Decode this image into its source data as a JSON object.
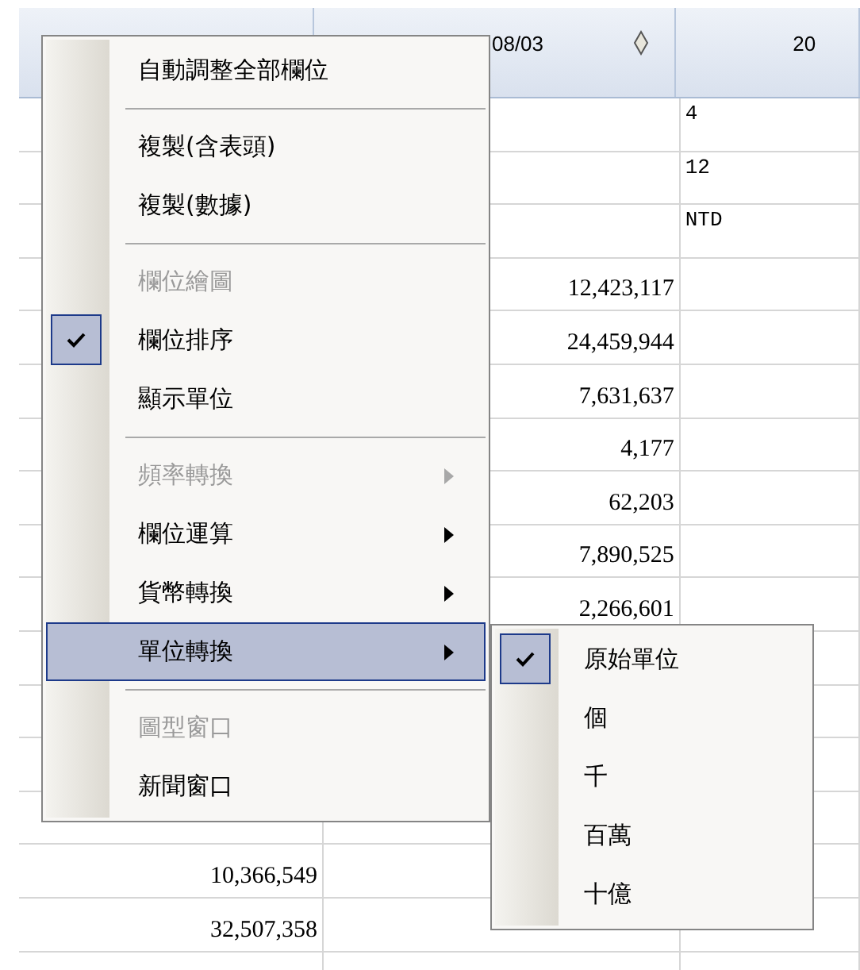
{
  "table": {
    "header": {
      "column_2": {
        "label": "08/03",
        "sort_icon": true
      },
      "column_3": {
        "label": "20"
      }
    },
    "rows": [
      {
        "column_3": "4"
      },
      {
        "column_3": "12"
      },
      {
        "column_3": "NTD"
      },
      {
        "column_2": "12,423,117"
      },
      {
        "column_2": "24,459,944"
      },
      {
        "column_2": "7,631,637"
      },
      {
        "column_2": "4,177"
      },
      {
        "column_2": "62,203"
      },
      {
        "column_2": "7,890,525"
      },
      {
        "column_2": "2,266,601"
      },
      {},
      {},
      {},
      {},
      {
        "column_1": "10,366,549"
      },
      {
        "column_1": "32,507,358"
      },
      {}
    ]
  },
  "context_menu": {
    "items": [
      {
        "kind": "item",
        "label": "自動調整全部欄位",
        "disabled": false,
        "checked": false,
        "submenu": false,
        "selected": false
      },
      {
        "kind": "separator"
      },
      {
        "kind": "item",
        "label": "複製(含表頭)",
        "disabled": false,
        "checked": false,
        "submenu": false,
        "selected": false
      },
      {
        "kind": "item",
        "label": "複製(數據)",
        "disabled": false,
        "checked": false,
        "submenu": false,
        "selected": false
      },
      {
        "kind": "separator"
      },
      {
        "kind": "item",
        "label": "欄位繪圖",
        "disabled": true,
        "checked": false,
        "submenu": false,
        "selected": false
      },
      {
        "kind": "item",
        "label": "欄位排序",
        "disabled": false,
        "checked": true,
        "submenu": false,
        "selected": false
      },
      {
        "kind": "item",
        "label": "顯示單位",
        "disabled": false,
        "checked": false,
        "submenu": false,
        "selected": false
      },
      {
        "kind": "separator"
      },
      {
        "kind": "item",
        "label": "頻率轉換",
        "disabled": true,
        "checked": false,
        "submenu": true,
        "selected": false
      },
      {
        "kind": "item",
        "label": "欄位運算",
        "disabled": false,
        "checked": false,
        "submenu": true,
        "selected": false
      },
      {
        "kind": "item",
        "label": "貨幣轉換",
        "disabled": false,
        "checked": false,
        "submenu": true,
        "selected": false
      },
      {
        "kind": "item",
        "label": "單位轉換",
        "disabled": false,
        "checked": false,
        "submenu": true,
        "selected": true
      },
      {
        "kind": "separator"
      },
      {
        "kind": "item",
        "label": "圖型窗口",
        "disabled": true,
        "checked": false,
        "submenu": false,
        "selected": false
      },
      {
        "kind": "item",
        "label": "新聞窗口",
        "disabled": false,
        "checked": false,
        "submenu": false,
        "selected": false
      }
    ]
  },
  "submenu": {
    "items": [
      {
        "label": "原始單位",
        "checked": true
      },
      {
        "label": "個",
        "checked": false
      },
      {
        "label": "千",
        "checked": false
      },
      {
        "label": "百萬",
        "checked": false
      },
      {
        "label": "十億",
        "checked": false
      }
    ]
  }
}
